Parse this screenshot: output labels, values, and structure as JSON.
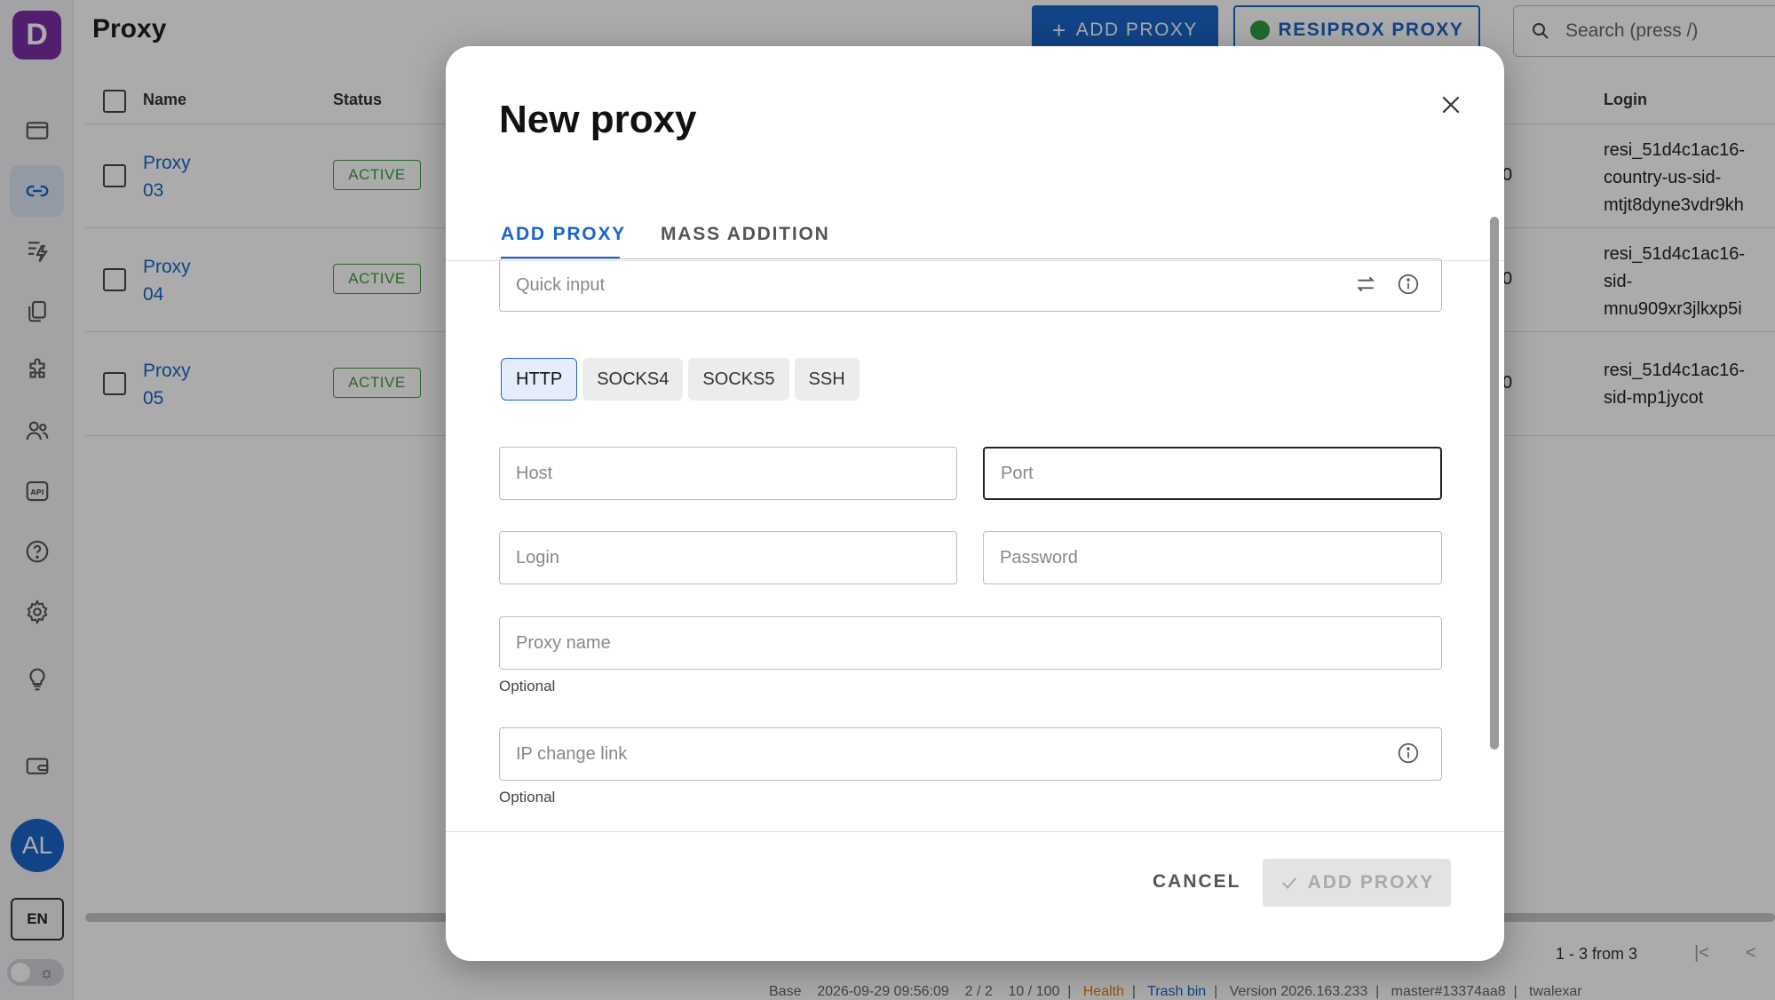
{
  "app": {
    "logo_letter": "D",
    "page_title": "Proxy"
  },
  "top_actions": {
    "add_proxy": "ADD PROXY",
    "resiprox": "RESIPROX PROXY",
    "search_placeholder": "Search (press /)"
  },
  "table": {
    "columns": {
      "name": "Name",
      "status": "Status",
      "login": "Login"
    },
    "rows": [
      {
        "name_line1": "Proxy",
        "name_line2": "03",
        "status": "ACTIVE",
        "num": "0",
        "login": [
          "resi_51d4c1ac16-",
          "country-us-sid-",
          "mtjt8dyne3vdr9kh"
        ]
      },
      {
        "name_line1": "Proxy",
        "name_line2": "04",
        "status": "ACTIVE",
        "num": "0",
        "login": [
          "resi_51d4c1ac16-",
          "sid-",
          "mnu909xr3jlkxp5i"
        ]
      },
      {
        "name_line1": "Proxy",
        "name_line2": "05",
        "status": "ACTIVE",
        "num": "0",
        "login": [
          "resi_51d4c1ac16-",
          "sid-mp1jycot"
        ]
      }
    ]
  },
  "pagination": {
    "range": "1 - 3 from 3"
  },
  "status_bar": {
    "base": "Base",
    "date": "2026-09-29 09:56:09",
    "users": "2 / 2",
    "profiles": "10 / 100",
    "health": "Health",
    "trash": "Trash bin",
    "version": "Version 2026.163.233",
    "branch": "master#13374aa8",
    "user": "twalexar"
  },
  "sidebar": {
    "avatar": "AL",
    "lang": "EN"
  },
  "modal": {
    "title": "New proxy",
    "tabs": [
      "ADD PROXY",
      "MASS ADDITION"
    ],
    "quick_input_placeholder": "Quick input",
    "types": [
      "HTTP",
      "SOCKS4",
      "SOCKS5",
      "SSH"
    ],
    "selected_type": "HTTP",
    "host_placeholder": "Host",
    "port_placeholder": "Port",
    "login_placeholder": "Login",
    "password_placeholder": "Password",
    "proxy_name_placeholder": "Proxy name",
    "proxy_name_helper": "Optional",
    "ip_change_placeholder": "IP change link",
    "ip_change_helper": "Optional",
    "cancel": "CANCEL",
    "submit": "ADD PROXY"
  },
  "colors": {
    "accent": "#1a65c8",
    "active_status": "#3c9a3c",
    "logo_bg": "#7b2fa5"
  }
}
